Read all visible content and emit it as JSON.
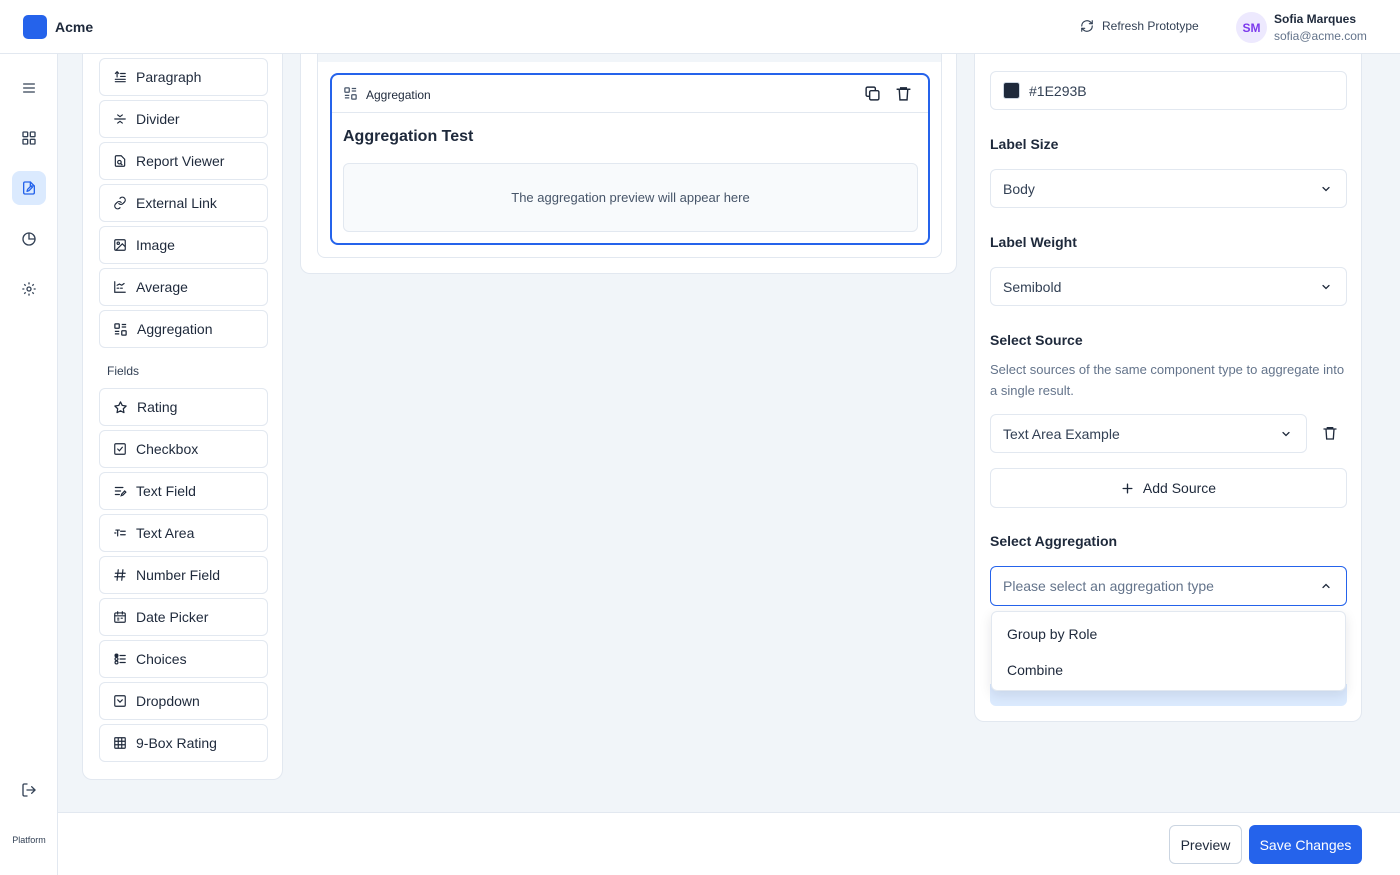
{
  "header": {
    "app_name": "Acme",
    "refresh_label": "Refresh Prototype",
    "user": {
      "initials": "SM",
      "name": "Sofia Marques",
      "email": "sofia@acme.com"
    }
  },
  "rail": {
    "bottom_label": "Platform"
  },
  "palette": {
    "layout_items": [
      {
        "label": "Paragraph",
        "icon": "paragraph-icon"
      },
      {
        "label": "Divider",
        "icon": "divider-icon"
      },
      {
        "label": "Report Viewer",
        "icon": "report-viewer-icon"
      },
      {
        "label": "External Link",
        "icon": "link-icon"
      },
      {
        "label": "Image",
        "icon": "image-icon"
      },
      {
        "label": "Average",
        "icon": "average-chart-icon"
      },
      {
        "label": "Aggregation",
        "icon": "aggregation-icon"
      }
    ],
    "fields_heading": "Fields",
    "field_items": [
      {
        "label": "Rating",
        "icon": "star-icon"
      },
      {
        "label": "Checkbox",
        "icon": "checkbox-icon"
      },
      {
        "label": "Text Field",
        "icon": "text-field-icon"
      },
      {
        "label": "Text Area",
        "icon": "text-area-icon"
      },
      {
        "label": "Number Field",
        "icon": "hash-icon"
      },
      {
        "label": "Date Picker",
        "icon": "calendar-icon"
      },
      {
        "label": "Choices",
        "icon": "choices-icon"
      },
      {
        "label": "Dropdown",
        "icon": "dropdown-icon"
      },
      {
        "label": "9-Box Rating",
        "icon": "grid-icon"
      }
    ]
  },
  "canvas": {
    "block_type_label": "Aggregation",
    "block_title": "Aggregation Test",
    "preview_text": "The aggregation preview will appear here"
  },
  "props": {
    "color_value": "#1E293B",
    "label_size_label": "Label Size",
    "label_size_value": "Body",
    "label_weight_label": "Label Weight",
    "label_weight_value": "Semibold",
    "select_source_label": "Select Source",
    "select_source_desc": "Select sources of the same component type to aggregate into a single result.",
    "source_value": "Text Area Example",
    "add_source_label": "Add Source",
    "select_aggregation_label": "Select Aggregation",
    "aggregation_placeholder": "Please select an aggregation type",
    "aggregation_options": [
      "Group by Role",
      "Combine"
    ]
  },
  "footer": {
    "preview_label": "Preview",
    "save_label": "Save Changes"
  },
  "colors": {
    "accent": "#2563eb",
    "swatch": "#1E293B",
    "text": "#1e293b",
    "border": "#e2e8f0"
  }
}
